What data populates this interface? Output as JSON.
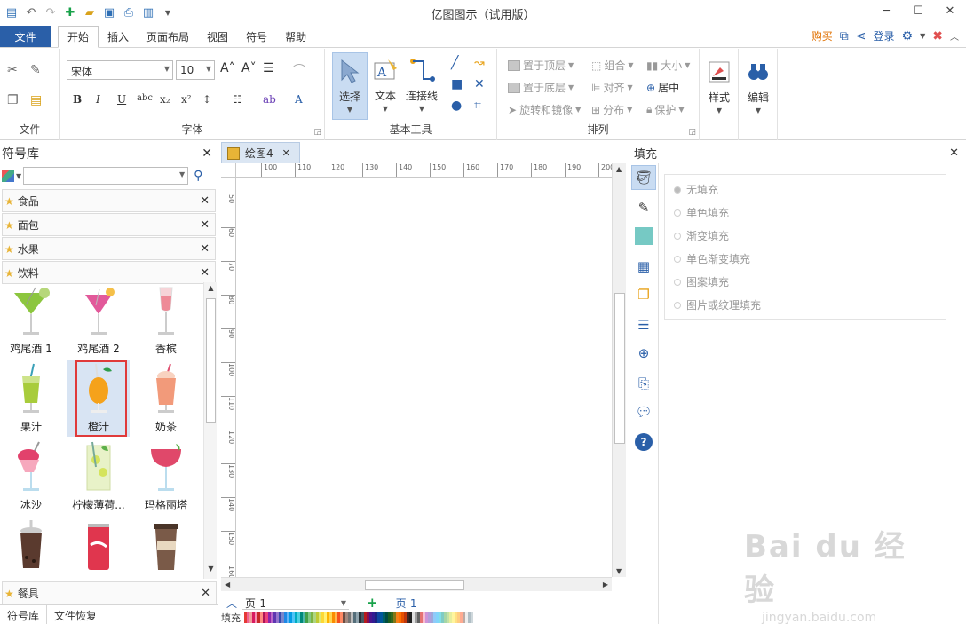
{
  "app": {
    "title": "亿图图示（试用版）"
  },
  "menu": {
    "file": "文件",
    "tabs": [
      "开始",
      "插入",
      "页面布局",
      "视图",
      "符号",
      "帮助"
    ],
    "buy": "购买",
    "login": "登录"
  },
  "ribbon": {
    "groups": {
      "file": "文件",
      "font": "字体",
      "basic_tools": "基本工具",
      "arrange": "排列"
    },
    "font_name": "宋体",
    "font_size": "10",
    "select_label": "选择",
    "text_label": "文本",
    "connector_label": "连接线",
    "style_label": "样式",
    "edit_label": "编辑",
    "arrange": {
      "bring_to_front": "置于顶层",
      "send_to_back": "置于底层",
      "rotate_mirror": "旋转和镜像",
      "group": "组合",
      "align": "对齐",
      "distribute": "分布",
      "size": "大小",
      "center": "居中",
      "protect": "保护"
    }
  },
  "library": {
    "title": "符号库",
    "categories": [
      "食品",
      "面包",
      "水果",
      "饮料"
    ],
    "bottom_category": "餐具",
    "symbols": [
      {
        "name": "鸡尾酒 1"
      },
      {
        "name": "鸡尾酒 2"
      },
      {
        "name": "香槟"
      },
      {
        "name": "果汁"
      },
      {
        "name": "橙汁"
      },
      {
        "name": "奶茶"
      },
      {
        "name": "冰沙"
      },
      {
        "name": "柠檬薄荷..."
      },
      {
        "name": "玛格丽塔"
      },
      {
        "name": ""
      },
      {
        "name": ""
      },
      {
        "name": ""
      }
    ],
    "tabs": [
      "符号库",
      "文件恢复"
    ]
  },
  "document": {
    "tab": "绘图4",
    "ruler_h": [
      "100",
      "110",
      "120",
      "130",
      "140",
      "150",
      "160",
      "170",
      "180",
      "190",
      "200"
    ],
    "ruler_v": [
      "50",
      "60",
      "70",
      "80",
      "90",
      "100",
      "110",
      "120",
      "130",
      "140",
      "150",
      "160"
    ],
    "page_select": "页-1",
    "page_tab": "页-1",
    "fill_label": "填充"
  },
  "fill_panel": {
    "title": "填充",
    "options": [
      "无填充",
      "单色填充",
      "渐变填充",
      "单色渐变填充",
      "图案填充",
      "图片或纹理填充"
    ],
    "selected_index": 0
  },
  "watermark": {
    "line1": "Bai du 经验",
    "line2": "jingyan.baidu.com"
  },
  "colors": {
    "accent": "#2a5fa8",
    "highlight": "#e03a3a",
    "buy": "#e07000"
  }
}
